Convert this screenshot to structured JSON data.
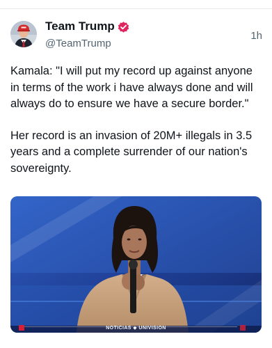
{
  "post": {
    "display_name": "Team Trump",
    "handle": "@TeamTrump",
    "timestamp": "1h",
    "paragraphs": [
      "Kamala: \"I will put my record up against anyone in terms of the work i have always done and will always do to ensure we have a secure border.\"",
      "Her record is an invasion of 20M+ illegals in 3.5 years and a complete surrender of our nation's sovereignty."
    ],
    "media": {
      "broadcaster_left": "NOTICIAS",
      "broadcaster_right": "UNIVISION"
    }
  },
  "colors": {
    "verified_badge": "#e0245e",
    "text_primary": "#0f1419",
    "text_secondary": "#536471",
    "stage_blue": "#2448a8"
  },
  "icons": {
    "verified": "verified-badge-icon",
    "avatar": "avatar"
  }
}
